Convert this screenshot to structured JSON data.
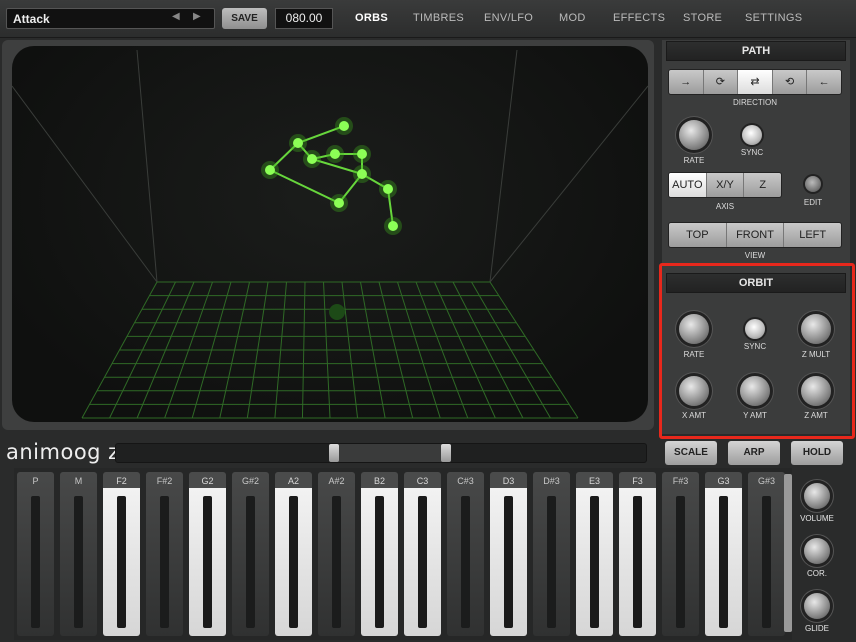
{
  "toolbar": {
    "preset_name": "Attack",
    "save_label": "SAVE",
    "bpm_value": "080.00",
    "tabs": [
      "ORBS",
      "TIMBRES",
      "ENV/LFO",
      "MOD",
      "EFFECTS",
      "STORE",
      "SETTINGS"
    ],
    "active_tab": "ORBS"
  },
  "path_panel": {
    "title": "PATH",
    "direction_label": "DIRECTION",
    "direction_options": [
      "→",
      "⟳",
      "⇄",
      "⟲",
      "←"
    ],
    "rate_label": "RATE",
    "sync_label": "SYNC",
    "axis_options": [
      "AUTO",
      "X/Y",
      "Z"
    ],
    "axis_label": "AXIS",
    "edit_label": "EDIT",
    "view_options": [
      "TOP",
      "FRONT",
      "LEFT"
    ],
    "view_label": "VIEW"
  },
  "orbit_panel": {
    "title": "ORBIT",
    "rate_label": "RATE",
    "sync_label": "SYNC",
    "zmult_label": "Z MULT",
    "xamt_label": "X AMT",
    "yamt_label": "Y AMT",
    "zamt_label": "Z AMT"
  },
  "bottom": {
    "logo": "animoog z",
    "scale_label": "SCALE",
    "arp_label": "ARP",
    "hold_label": "HOLD",
    "volume_label": "VOLUME",
    "cor_label": "COR.",
    "glide_label": "GLIDE"
  },
  "keys": [
    {
      "label": "P",
      "shade": "dark"
    },
    {
      "label": "M",
      "shade": "dark"
    },
    {
      "label": "F2",
      "shade": "light"
    },
    {
      "label": "F#2",
      "shade": "dark"
    },
    {
      "label": "G2",
      "shade": "light"
    },
    {
      "label": "G#2",
      "shade": "dark"
    },
    {
      "label": "A2",
      "shade": "light"
    },
    {
      "label": "A#2",
      "shade": "dark"
    },
    {
      "label": "B2",
      "shade": "light"
    },
    {
      "label": "C3",
      "shade": "light"
    },
    {
      "label": "C#3",
      "shade": "dark"
    },
    {
      "label": "D3",
      "shade": "light"
    },
    {
      "label": "D#3",
      "shade": "dark"
    },
    {
      "label": "E3",
      "shade": "light"
    },
    {
      "label": "F3",
      "shade": "light"
    },
    {
      "label": "F#3",
      "shade": "dark"
    },
    {
      "label": "G3",
      "shade": "light"
    },
    {
      "label": "G#3",
      "shade": "dark"
    }
  ],
  "colors": {
    "orb_green": "#7dff4a",
    "grid_green": "#2f6a26",
    "highlight_red": "#e8281c"
  }
}
